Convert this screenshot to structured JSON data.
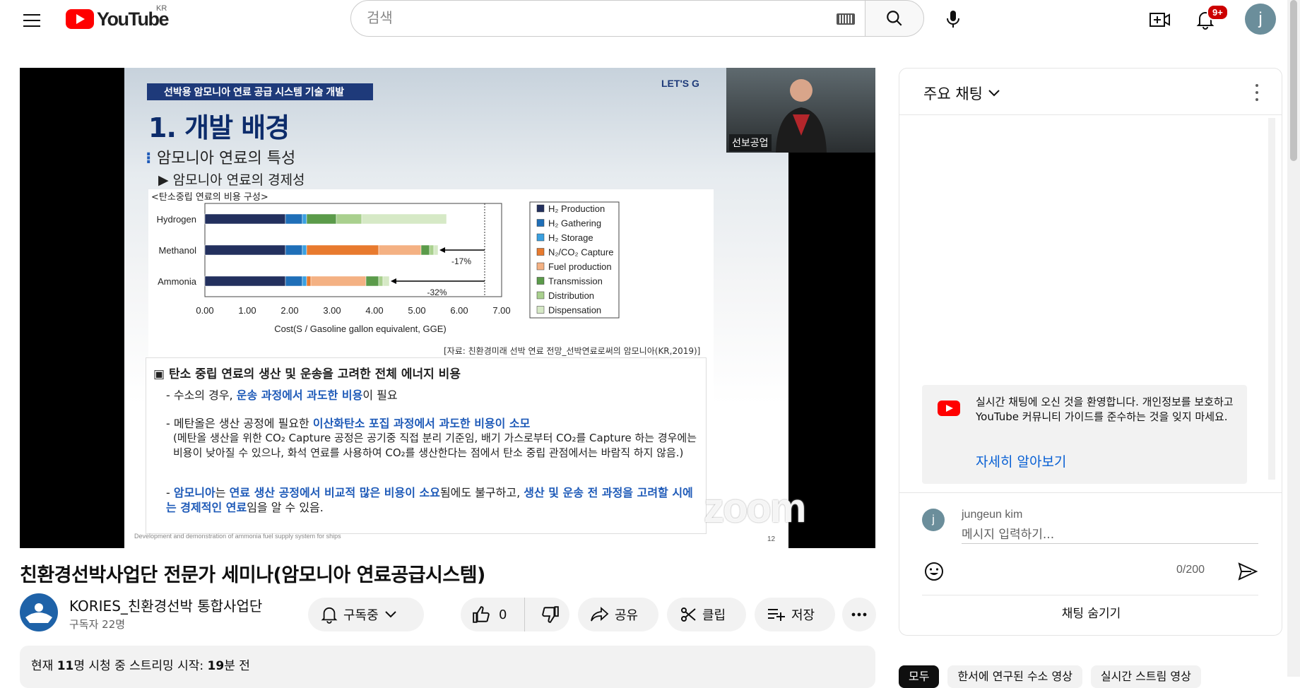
{
  "header": {
    "logo_text": "YouTube",
    "country_code": "KR",
    "search_placeholder": "검색",
    "notification_count": "9+",
    "avatar_letter": "j"
  },
  "slide": {
    "band": "선박용 암모니아 연료 공급 시스템 기술 개발",
    "corner_logo": "LET'S G",
    "heading": "1. 개발 배경",
    "subheading": "암모니아 연료의 특성",
    "subsubheading": "▶ 암모니아 연료의 경제성",
    "chart_caption": "<탄소중립 연료의 비용 구성>",
    "source": "[자료: 친환경미래 선박 연료 전망_선박연료로써의 암모니아(KR,2019)]",
    "notes_heading": "▣ 탄소 중립 연료의 생산 및 운송을 고려한 전체 에너지 비용",
    "note1_pre": "- 수소의 경우, ",
    "note1_hl": "운송 과정에서 과도한 비용",
    "note1_post": "이 필요",
    "note2_pre": "- 메탄올은 생산 공정에 필요한 ",
    "note2_hl": "이산화탄소 포집 과정에서 과도한 비용이 소모",
    "note2_sub": "(메탄올 생산을 위한 CO₂ Capture 공정은 공기중 직접 분리 기준임, 배기 가스로부터 CO₂를 Capture 하는 경우에는 비용이 낮아질 수 있으나, 화석 연료를 사용하여 CO₂를 생산한다는 점에서 탄소 중립 관점에서는 바람직 하지 않음.)",
    "note3_hl1": "암모니아",
    "note3_a": "는 ",
    "note3_hl2": "연료 생산 공정에서 비교적 많은 비용이 소요",
    "note3_b": "됨에도 불구하고, ",
    "note3_hl3": "생산 및 운송 전 과정을 고려할 시에는 경제적인 연료",
    "note3_c": "임을 알 수 있음.",
    "footer_text": "Development and demonstration of ammonia fuel supply system for ships",
    "page_number": "12",
    "zoom_watermark": "zoom",
    "camera_label": "선보공업"
  },
  "chart_data": {
    "type": "bar",
    "stacked": true,
    "orientation": "horizontal",
    "title": "",
    "xlabel": "Cost(S / Gasoline gallon equivalent, GGE)",
    "xlim": [
      0,
      7
    ],
    "x_ticks": [
      "0.00",
      "1.00",
      "2.00",
      "3.00",
      "4.00",
      "5.00",
      "6.00",
      "7.00"
    ],
    "categories": [
      "Hydrogen",
      "Methanol",
      "Ammonia"
    ],
    "series": [
      {
        "name": "H₂ Production",
        "color": "#23305e",
        "values": [
          1.9,
          1.9,
          1.9
        ]
      },
      {
        "name": "H₂ Gathering",
        "color": "#1f6fb8",
        "values": [
          0.4,
          0.4,
          0.4
        ]
      },
      {
        "name": "H₂ Storage",
        "color": "#3aa0e0",
        "values": [
          0.1,
          0.1,
          0.1
        ]
      },
      {
        "name": "N₂/CO₂ Capture",
        "color": "#e87a2e",
        "values": [
          0.0,
          1.7,
          0.1
        ]
      },
      {
        "name": "Fuel production",
        "color": "#f4b183",
        "values": [
          0.0,
          1.0,
          1.3
        ]
      },
      {
        "name": "Transmission",
        "color": "#5b9b4a",
        "values": [
          0.7,
          0.2,
          0.3
        ]
      },
      {
        "name": "Distribution",
        "color": "#a9d08e",
        "values": [
          0.6,
          0.1,
          0.1
        ]
      },
      {
        "name": "Dispensation",
        "color": "#d6e9c6",
        "values": [
          2.0,
          0.1,
          0.15
        ]
      }
    ],
    "annotations": [
      "-17%",
      "-32%"
    ],
    "legend_position": "right"
  },
  "video": {
    "title": "친환경선박사업단 전문가 세미나(암모니아 연료공급시스템)",
    "channel_name": "KORIES_친환경선박 통합사업단",
    "subscribers": "구독자 22명",
    "subscribe_label": "구독중",
    "like_count": "0",
    "share_label": "공유",
    "clip_label": "클립",
    "save_label": "저장",
    "desc_pre": "현재 ",
    "desc_viewers": "11",
    "desc_mid": "명 시청 중  스트리밍 시작: ",
    "desc_minutes": "19",
    "desc_post": "분 전"
  },
  "chat": {
    "title": "주요 채팅",
    "welcome": "실시간 채팅에 오신 것을 환영합니다. 개인정보를 보호하고 YouTube 커뮤니티 가이드를 준수하는 것을 잊지 마세요.",
    "learn_more": "자세히 알아보기",
    "user_name": "jungeun kim",
    "user_initial": "j",
    "input_placeholder": "메시지 입력하기...",
    "counter": "0/200",
    "hide_chat": "채팅 숨기기"
  },
  "chips": [
    "모두",
    "한서에 연구된 수소 영상",
    "실시간 스트림 영상"
  ]
}
